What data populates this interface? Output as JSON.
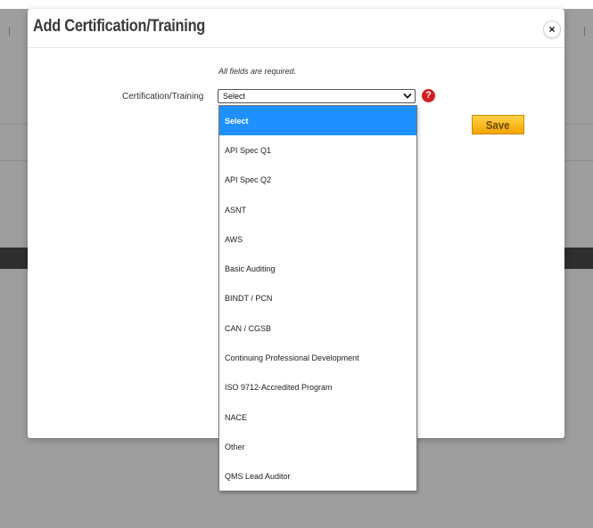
{
  "modal": {
    "title": "Add Certification/Training",
    "close_symbol": "×",
    "required_note": "All fields are required.",
    "field_label": "Certification/Training",
    "select_value": "Select",
    "select_chevron": "⌄",
    "help_symbol": "?",
    "save_label": "Save"
  },
  "dropdown": {
    "selected_index": 0,
    "options": [
      "Select",
      "API Spec Q1",
      "API Spec Q2",
      "ASNT",
      "AWS",
      "Basic Auditing",
      "BINDT / PCN",
      "CAN / CGSB",
      "Continuing Professional Development",
      "ISO 9712-Accredited Program",
      "NACE",
      "Other",
      "QMS Lead Auditor"
    ]
  },
  "colors": {
    "overlay": "#9e9e9e",
    "selected_option": "#1e90ff",
    "save_button": "#f3a400",
    "help_icon": "#d41f1f"
  }
}
